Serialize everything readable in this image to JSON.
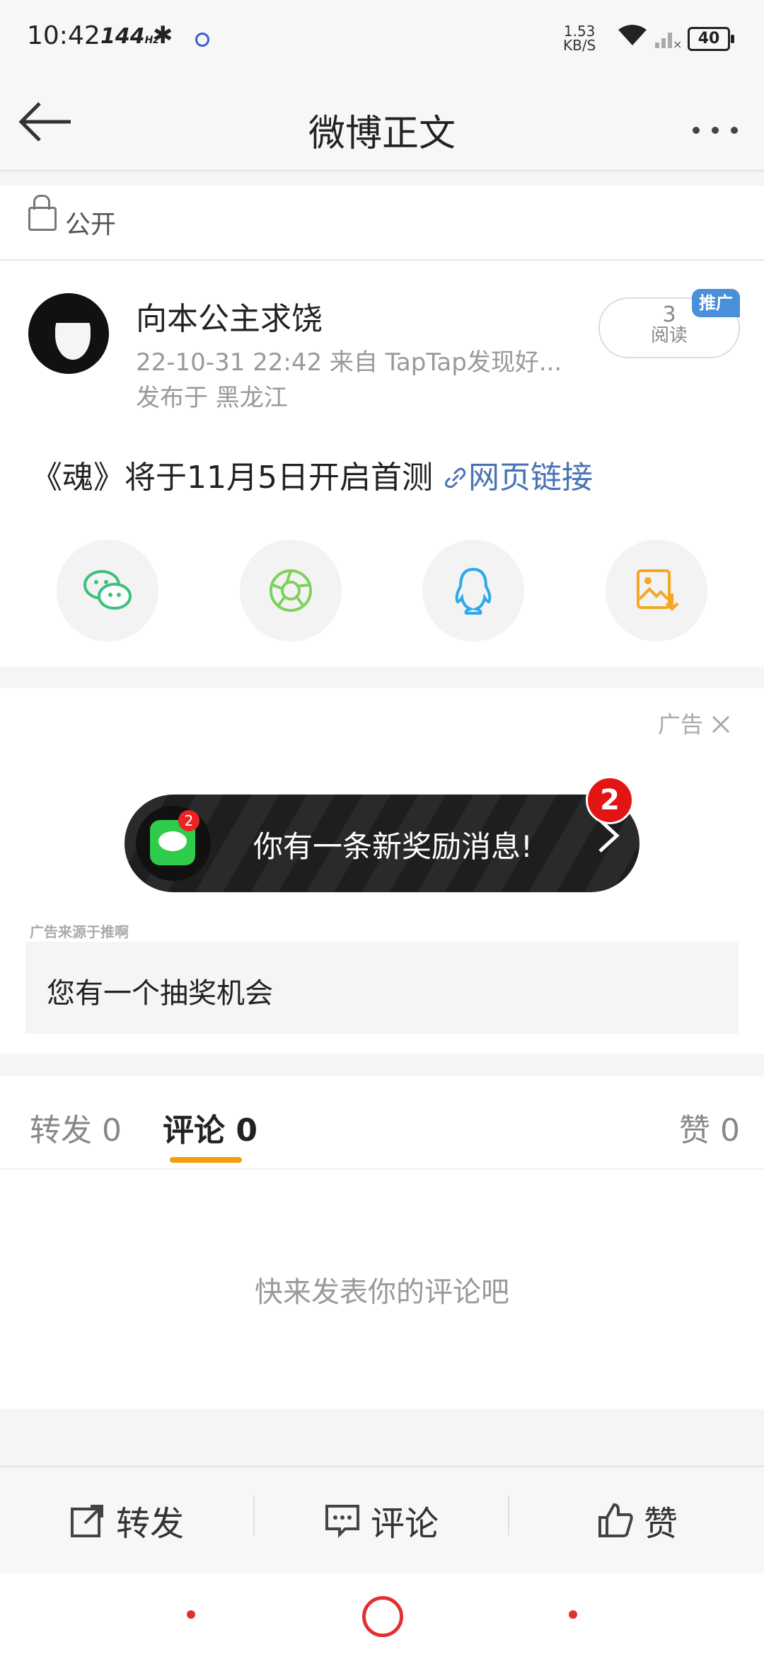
{
  "status_bar": {
    "time": "10:42",
    "refresh_rate": "144",
    "refresh_unit": "Hz",
    "net_speed_value": "1.53",
    "net_speed_unit": "KB/S",
    "battery": "40"
  },
  "nav": {
    "title": "微博正文",
    "back_icon": "back-arrow-icon",
    "more_icon": "more-dots-icon"
  },
  "visibility": {
    "label": "公开",
    "icon": "unlock-icon"
  },
  "post": {
    "user_name": "向本公主求饶",
    "meta": "22-10-31 22:42   来自 TapTap发现好...",
    "location": "发布于 黑龙江",
    "read_count": "3",
    "read_label": "阅读",
    "promo_tag": "推广",
    "text": "《魂》将于11月5日开启首测 ",
    "link_text": "网页链接"
  },
  "share": {
    "items": [
      {
        "name": "wechat-icon",
        "color": "#3cc07a"
      },
      {
        "name": "moments-icon",
        "color": "#7ed15a"
      },
      {
        "name": "qq-icon",
        "color": "#2fa9e8"
      },
      {
        "name": "save-image-icon",
        "color": "#f5a623"
      }
    ]
  },
  "ad": {
    "label": "广告",
    "banner_text": "你有一条新奖励消息!",
    "badge_count": "2",
    "icon_badge": "2",
    "source": "广告来源于推啊",
    "cta_text": "您有一个抽奖机会"
  },
  "tabs": {
    "repost": "转发 0",
    "comment": "评论 0",
    "like": "赞 0"
  },
  "comments": {
    "empty_text": "快来发表你的评论吧"
  },
  "actions": {
    "repost": "转发",
    "comment": "评论",
    "like": "赞"
  },
  "colors": {
    "accent": "#f39c12",
    "link": "#4a73b5",
    "promo": "#4a90d9",
    "system_nav": "#e03131"
  }
}
